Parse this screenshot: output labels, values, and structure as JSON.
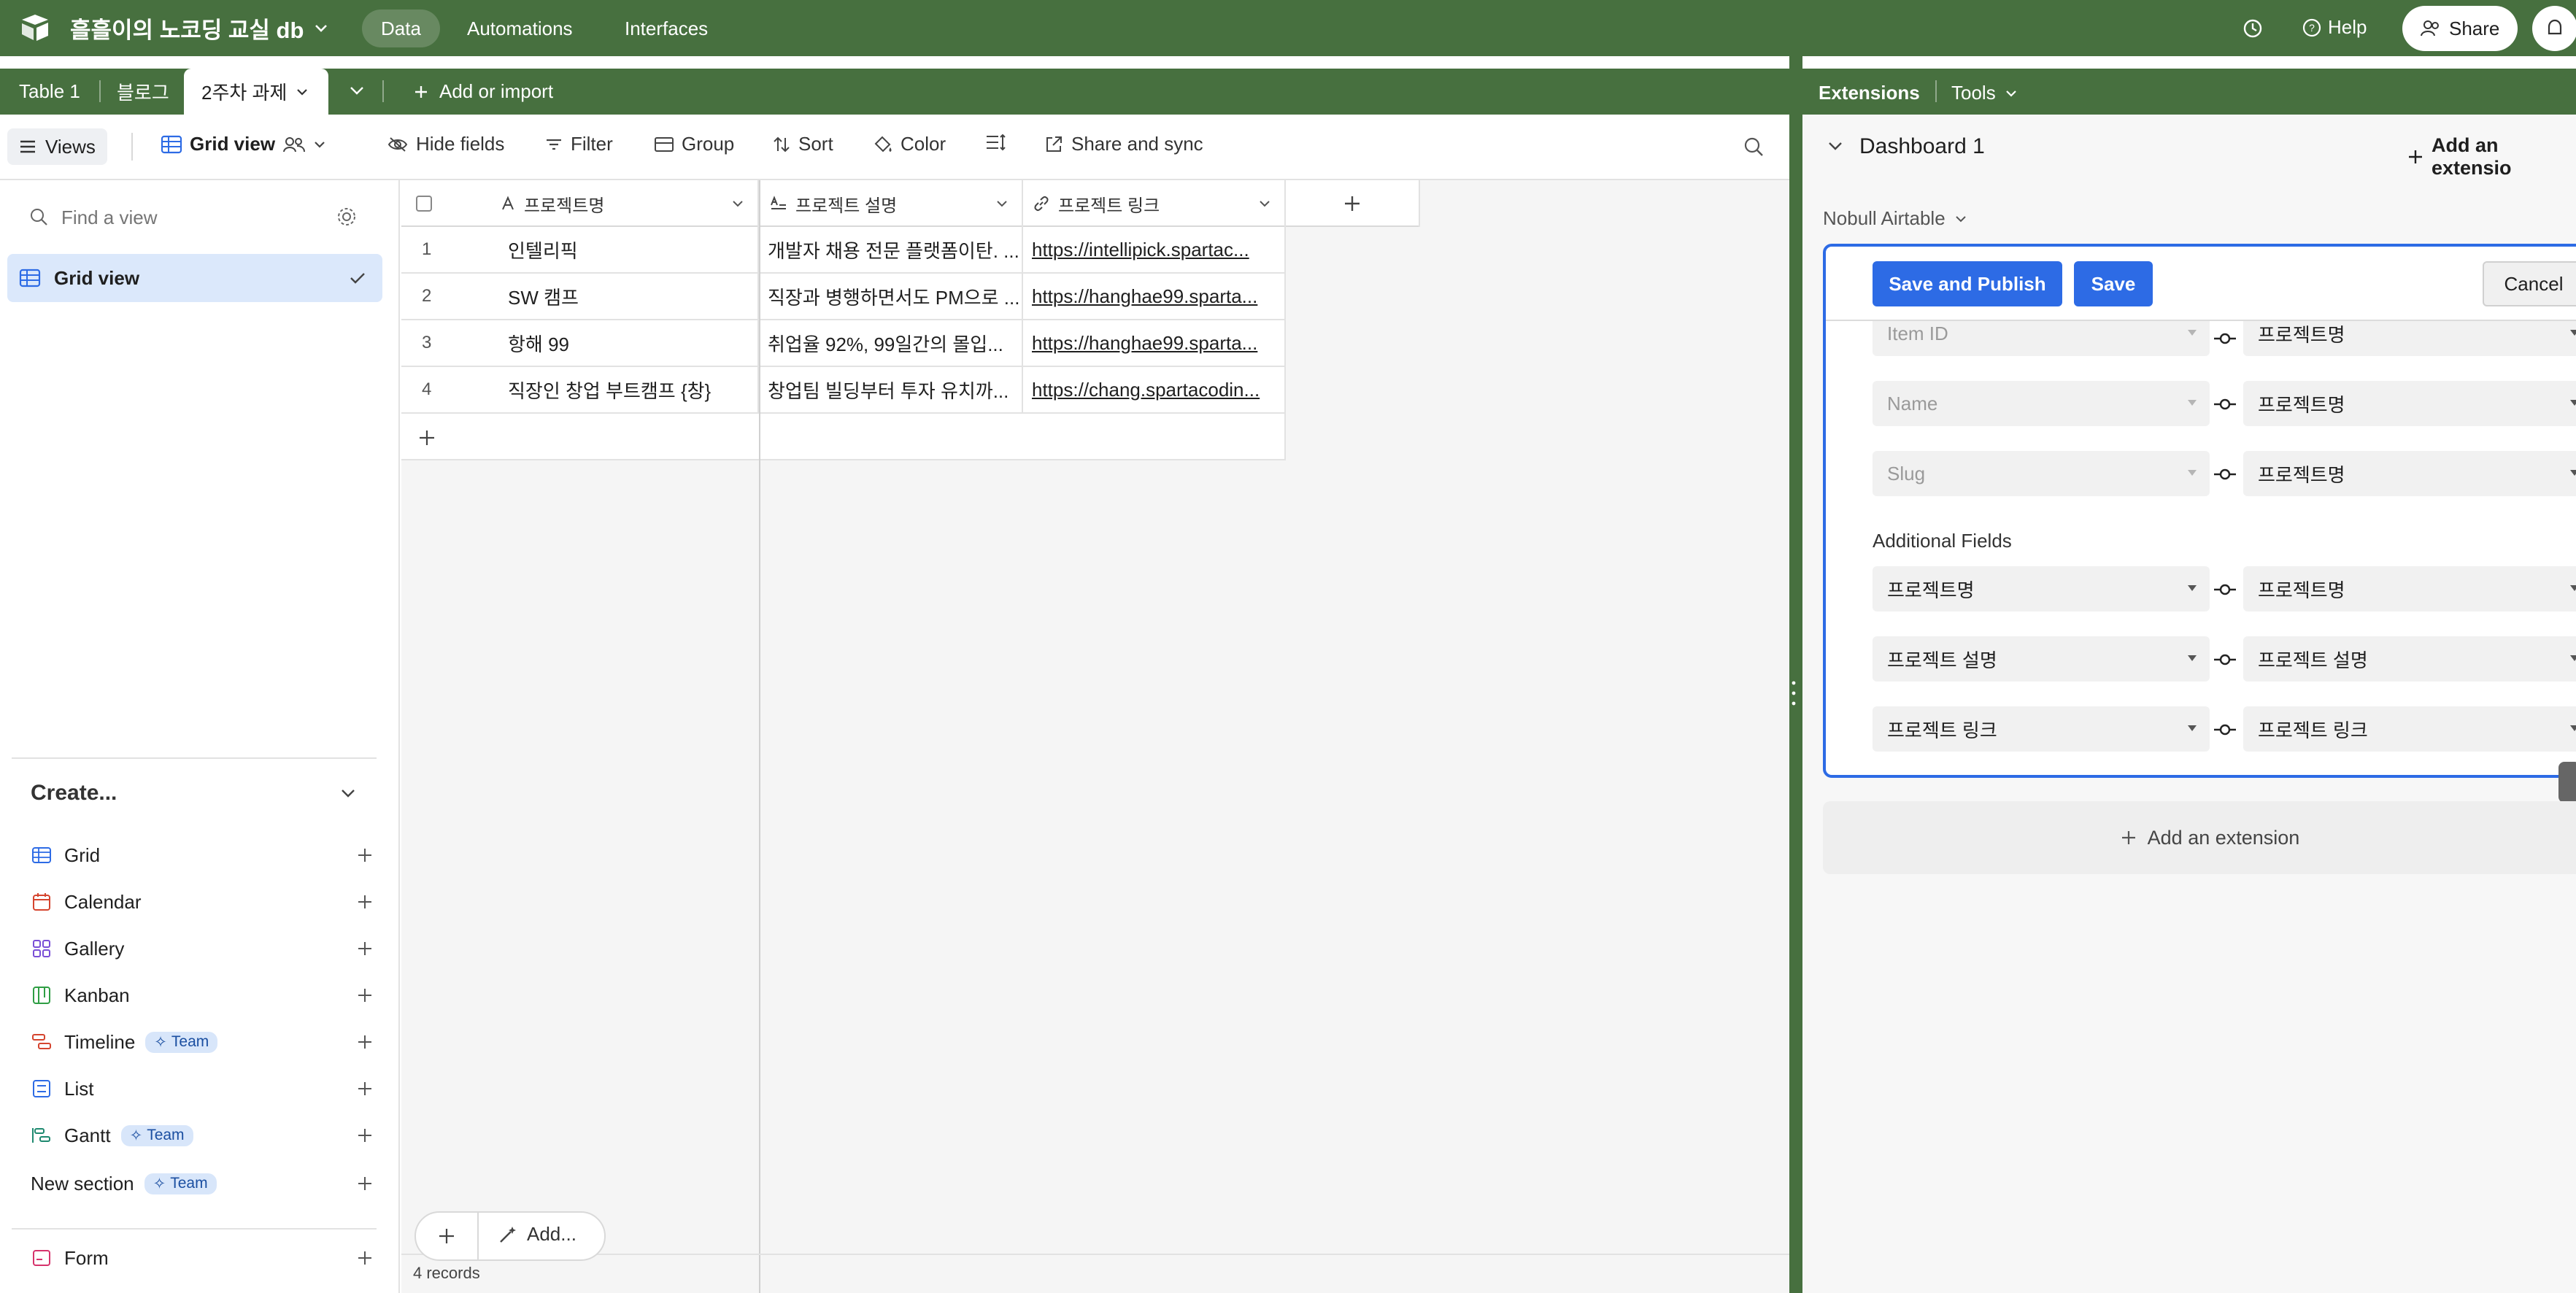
{
  "topbar": {
    "base_name": "흘흘이의 노코딩 교실 db",
    "nav": [
      "Data",
      "Automations",
      "Interfaces"
    ],
    "help_label": "Help",
    "share_label": "Share"
  },
  "tabs": {
    "items": [
      "Table 1",
      "블로그"
    ],
    "active": "2주차 과제",
    "add_label": "Add or import"
  },
  "extensions_header": {
    "title": "Extensions",
    "tools_label": "Tools"
  },
  "toolbar": {
    "views_label": "Views",
    "view_name": "Grid view",
    "hide_fields": "Hide fields",
    "filter": "Filter",
    "group": "Group",
    "sort": "Sort",
    "color": "Color",
    "share_sync": "Share and sync"
  },
  "sidebar": {
    "find_placeholder": "Find a view",
    "active_view": "Grid view",
    "create_heading": "Create...",
    "create_items": [
      {
        "label": "Grid",
        "icon": "grid-icon",
        "team": false
      },
      {
        "label": "Calendar",
        "icon": "calendar-icon",
        "team": false
      },
      {
        "label": "Gallery",
        "icon": "gallery-icon",
        "team": false
      },
      {
        "label": "Kanban",
        "icon": "kanban-icon",
        "team": false
      },
      {
        "label": "Timeline",
        "icon": "timeline-icon",
        "team": true
      },
      {
        "label": "List",
        "icon": "list-icon",
        "team": false
      },
      {
        "label": "Gantt",
        "icon": "gantt-icon",
        "team": true
      },
      {
        "label": "New section",
        "icon": "",
        "team": true
      }
    ],
    "team_label": "Team",
    "form_label": "Form"
  },
  "grid": {
    "columns": [
      "프로젝트명",
      "프로젝트 설명",
      "프로젝트 링크"
    ],
    "rows": [
      {
        "num": "1",
        "name": "인텔리픽",
        "desc": "개발자 채용 전문 플랫폼이탄. ...",
        "link": "https://intellipick.spartac..."
      },
      {
        "num": "2",
        "name": "SW 캠프",
        "desc": "직장과 병행하면서도 PM으로 ...",
        "link": "https://hanghae99.sparta..."
      },
      {
        "num": "3",
        "name": "항해 99",
        "desc": "취업율 92%, 99일간의 몰입...",
        "link": "https://hanghae99.sparta..."
      },
      {
        "num": "4",
        "name": "직장인 창업 부트캠프 {창}",
        "desc": "창업팀 빌딩부터 투자 유치까...",
        "link": "https://chang.spartacodin..."
      }
    ],
    "add_label": "Add...",
    "records_count": "4 records"
  },
  "dashboard": {
    "title": "Dashboard 1",
    "add_extension_top": "Add an extensio",
    "extension_name": "Nobull Airtable",
    "save_publish": "Save and Publish",
    "save": "Save",
    "cancel": "Cancel",
    "required_mappings": [
      {
        "left": "Item ID",
        "right": "프로젝트명"
      },
      {
        "left": "Name",
        "right": "프로젝트명"
      },
      {
        "left": "Slug",
        "right": "프로젝트명"
      }
    ],
    "additional_heading": "Additional Fields",
    "additional_mappings": [
      {
        "left": "프로젝트명",
        "right": "프로젝트명"
      },
      {
        "left": "프로젝트 설명",
        "right": "프로젝트 설명"
      },
      {
        "left": "프로젝트 링크",
        "right": "프로젝트 링크"
      }
    ],
    "add_extension_bottom": "Add an extension"
  },
  "colors": {
    "brand_green": "#47703f",
    "accent_blue": "#2d6be5",
    "selected_view_bg": "#dbe8fb"
  }
}
